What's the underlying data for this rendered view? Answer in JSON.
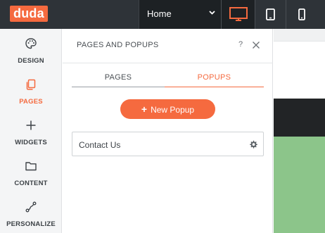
{
  "topbar": {
    "logo": "duda",
    "page_selector": "Home",
    "devices": [
      "desktop-icon",
      "tablet-icon",
      "mobile-icon"
    ]
  },
  "sidebar": {
    "items": [
      {
        "label": "DESIGN",
        "icon": "palette-icon"
      },
      {
        "label": "PAGES",
        "icon": "pages-icon",
        "active": true
      },
      {
        "label": "WIDGETS",
        "icon": "plus-icon"
      },
      {
        "label": "CONTENT",
        "icon": "folder-icon"
      },
      {
        "label": "PERSONALIZE",
        "icon": "route-icon"
      }
    ]
  },
  "panel": {
    "title": "PAGES AND POPUPS",
    "help": "?",
    "tabs": [
      {
        "label": "PAGES"
      },
      {
        "label": "POPUPS",
        "active": true
      }
    ],
    "new_popup_label": "New Popup",
    "popups": [
      {
        "name": "Contact Us"
      }
    ]
  },
  "colors": {
    "accent": "#f56a3f",
    "topbar": "#2e3338",
    "preview_green": "#8cc58a"
  }
}
